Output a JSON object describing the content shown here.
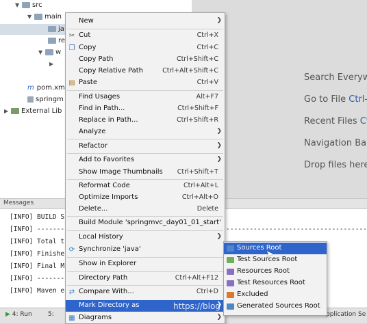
{
  "tree": {
    "items": [
      {
        "label": "src"
      },
      {
        "label": "main"
      },
      {
        "label": "ja"
      },
      {
        "label": "re"
      },
      {
        "label": "w"
      },
      {
        "label": "pom.xm"
      },
      {
        "label": "springm"
      },
      {
        "label": "External Lib"
      }
    ]
  },
  "editor_hints": {
    "search": "Search Everywh",
    "goto": "Go to File",
    "goto_key": "Ctrl-",
    "recent": "Recent Files",
    "recent_key": "Ct",
    "navbar": "Navigation Bar",
    "drop": "Drop files here"
  },
  "messages": {
    "title": "Messages",
    "lines": [
      "[INFO] BUILD S",
      "[INFO] -------",
      "[INFO] Total t",
      "[INFO] Finishe",
      "[INFO] Final M",
      "[INFO] -------",
      "[INFO] Maven e"
    ],
    "trailing_dashes": "------------------------------------"
  },
  "status": {
    "run": "4: Run",
    "tab5": "5:",
    "app_se": "pplication Se"
  },
  "menu": {
    "items": [
      {
        "label": "New",
        "shortcut": "",
        "submenu": true
      },
      {
        "label": "Cut",
        "shortcut": "Ctrl+X",
        "icon": "scissors-icon"
      },
      {
        "label": "Copy",
        "shortcut": "Ctrl+C",
        "icon": "copy-icon"
      },
      {
        "label": "Copy Path",
        "shortcut": "Ctrl+Shift+C"
      },
      {
        "label": "Copy Relative Path",
        "shortcut": "Ctrl+Alt+Shift+C"
      },
      {
        "label": "Paste",
        "shortcut": "Ctrl+V",
        "icon": "paste-icon"
      },
      {
        "label": "Find Usages",
        "shortcut": "Alt+F7"
      },
      {
        "label": "Find in Path...",
        "shortcut": "Ctrl+Shift+F"
      },
      {
        "label": "Replace in Path...",
        "shortcut": "Ctrl+Shift+R"
      },
      {
        "label": "Analyze",
        "shortcut": "",
        "submenu": true
      },
      {
        "label": "Refactor",
        "shortcut": "",
        "submenu": true
      },
      {
        "label": "Add to Favorites",
        "shortcut": "",
        "submenu": true
      },
      {
        "label": "Show Image Thumbnails",
        "shortcut": "Ctrl+Shift+T"
      },
      {
        "label": "Reformat Code",
        "shortcut": "Ctrl+Alt+L"
      },
      {
        "label": "Optimize Imports",
        "shortcut": "Ctrl+Alt+O"
      },
      {
        "label": "Delete...",
        "shortcut": "Delete"
      },
      {
        "label": "Build Module 'springmvc_day01_01_start'",
        "shortcut": ""
      },
      {
        "label": "Local History",
        "shortcut": "",
        "submenu": true
      },
      {
        "label": "Synchronize 'java'",
        "shortcut": "",
        "icon": "sync-icon"
      },
      {
        "label": "Show in Explorer",
        "shortcut": ""
      },
      {
        "label": "Directory Path",
        "shortcut": "Ctrl+Alt+F12"
      },
      {
        "label": "Compare With...",
        "shortcut": "Ctrl+D",
        "icon": "compare-icon"
      },
      {
        "label": "Mark Directory as",
        "shortcut": "",
        "submenu": true
      },
      {
        "label": "Diagrams",
        "shortcut": "",
        "submenu": true,
        "icon": "diagram-icon"
      }
    ]
  },
  "submenu": {
    "items": [
      {
        "label": "Sources Root",
        "color": "#4e86c7"
      },
      {
        "label": "Test Sources Root",
        "color": "#6fae5d"
      },
      {
        "label": "Resources Root",
        "color": "#8a6fbf"
      },
      {
        "label": "Test Resources Root",
        "color": "#8a6fbf"
      },
      {
        "label": "Excluded",
        "color": "#d9792f"
      },
      {
        "label": "Generated Sources Root",
        "color": "#4e86c7"
      }
    ]
  },
  "watermark": "https://blog"
}
